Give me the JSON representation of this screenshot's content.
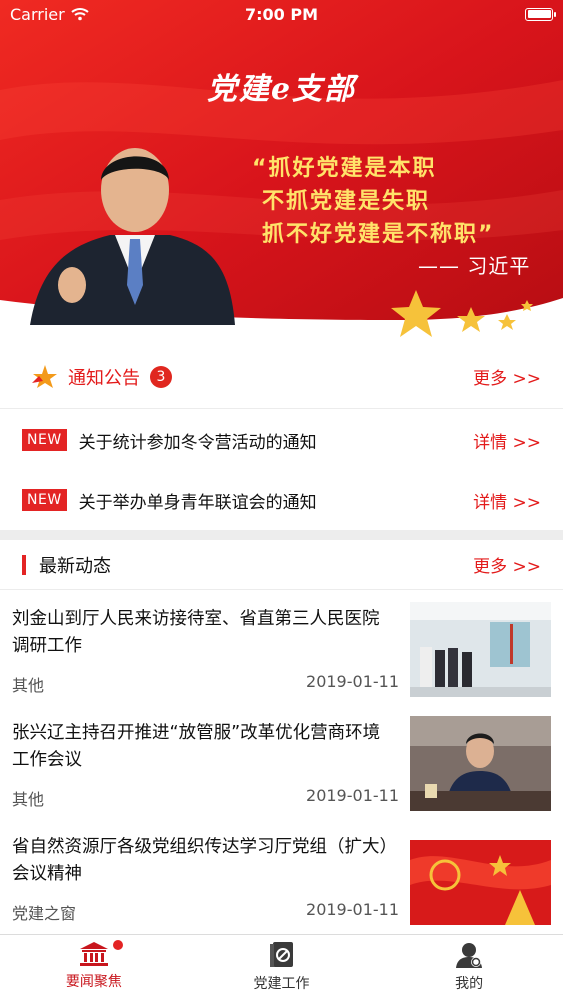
{
  "status_bar": {
    "carrier": "Carrier",
    "time": "7:00 PM"
  },
  "banner": {
    "app_title": "党建e支部",
    "quote_line1": "“抓好党建是本职",
    "quote_line2": "不抓党建是失职",
    "quote_line3": "抓不好党建是不称职”",
    "quote_author": "—— 习近平"
  },
  "notices": {
    "title": "通知公告",
    "count": "3",
    "more": "更多 >>",
    "items": [
      {
        "badge": "NEW",
        "text": "关于统计参加冬令营活动的通知",
        "detail": "详情 >>"
      },
      {
        "badge": "NEW",
        "text": "关于举办单身青年联谊会的通知",
        "detail": "详情 >>"
      }
    ]
  },
  "news": {
    "title": "最新动态",
    "more": "更多 >>",
    "items": [
      {
        "headline": "刘金山到厅人民来访接待室、省直第三人民医院调研工作",
        "category": "其他",
        "date": "2019-01-11"
      },
      {
        "headline": "张兴辽主持召开推进“放管服”改革优化营商环境工作会议",
        "category": "其他",
        "date": "2019-01-11"
      },
      {
        "headline": "省自然资源厅各级党组织传达学习厅党组（扩大）会议精神",
        "category": "党建之窗",
        "date": "2019-01-11"
      }
    ]
  },
  "tab_bar": {
    "tabs": [
      {
        "label": "要闻聚焦",
        "icon": "bank-icon",
        "active": true
      },
      {
        "label": "党建工作",
        "icon": "party-book-icon",
        "active": false
      },
      {
        "label": "我的",
        "icon": "user-icon",
        "active": false
      }
    ]
  },
  "colors": {
    "primary_red": "#e31b1b",
    "banner_red": "#d8141b",
    "quote_yellow": "#ffe36a"
  }
}
